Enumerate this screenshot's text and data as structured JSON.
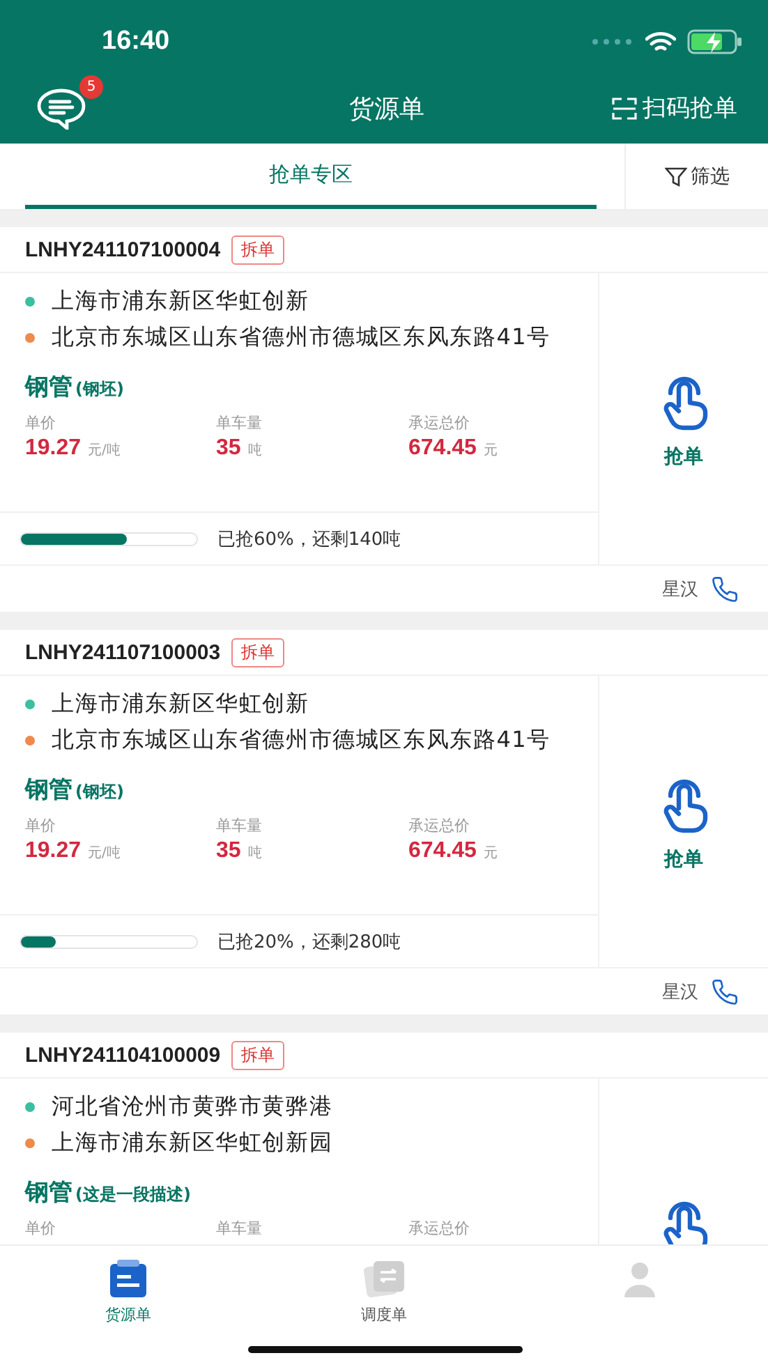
{
  "status_bar": {
    "time": "16:40"
  },
  "header": {
    "message_badge": "5",
    "title": "货源单",
    "scan_action": "扫码抢单"
  },
  "tabs": [
    {
      "label": "抢单专区",
      "selected": true
    }
  ],
  "filter": {
    "label": "筛选"
  },
  "orders": [
    {
      "number": "LNHY241107100004",
      "tag": "拆单",
      "from": "上海市浦东新区华虹创新",
      "to": "北京市东城区山东省德州市德城区东风东路41号",
      "cargo": "钢管",
      "cargo_note": "(钢坯)",
      "stats": [
        {
          "label": "单价",
          "value": "19.27",
          "unit": "元/吨"
        },
        {
          "label": "单车量",
          "value": "35",
          "unit": "吨"
        },
        {
          "label": "承运总价",
          "value": "674.45",
          "unit": "元"
        }
      ],
      "progress": {
        "level": 0.6,
        "text": "已抢60%，还剩140吨"
      },
      "grab_label": "抢单",
      "contact": "星汉"
    },
    {
      "number": "LNHY241107100003",
      "tag": "拆单",
      "from": "上海市浦东新区华虹创新",
      "to": "北京市东城区山东省德州市德城区东风东路41号",
      "cargo": "钢管",
      "cargo_note": "(钢坯)",
      "stats": [
        {
          "label": "单价",
          "value": "19.27",
          "unit": "元/吨"
        },
        {
          "label": "单车量",
          "value": "35",
          "unit": "吨"
        },
        {
          "label": "承运总价",
          "value": "674.45",
          "unit": "元"
        }
      ],
      "progress": {
        "level": 0.2,
        "text": "已抢20%，还剩280吨"
      },
      "grab_label": "抢单",
      "contact": "星汉"
    },
    {
      "number": "LNHY241104100009",
      "tag": "拆单",
      "from": "河北省沧州市黄骅市黄骅港",
      "to": "上海市浦东新区华虹创新园",
      "cargo": "钢管",
      "cargo_note": "(这是一段描述)",
      "stats": [
        {
          "label": "单价"
        },
        {
          "label": "单车量"
        },
        {
          "label": "承运总价"
        }
      ]
    }
  ],
  "tab_bar": [
    {
      "kind": "cargo",
      "label": "货源单",
      "selected": true
    },
    {
      "kind": "dispatch",
      "label": "调度单",
      "selected": false
    },
    {
      "kind": "profile",
      "selected": false
    }
  ]
}
